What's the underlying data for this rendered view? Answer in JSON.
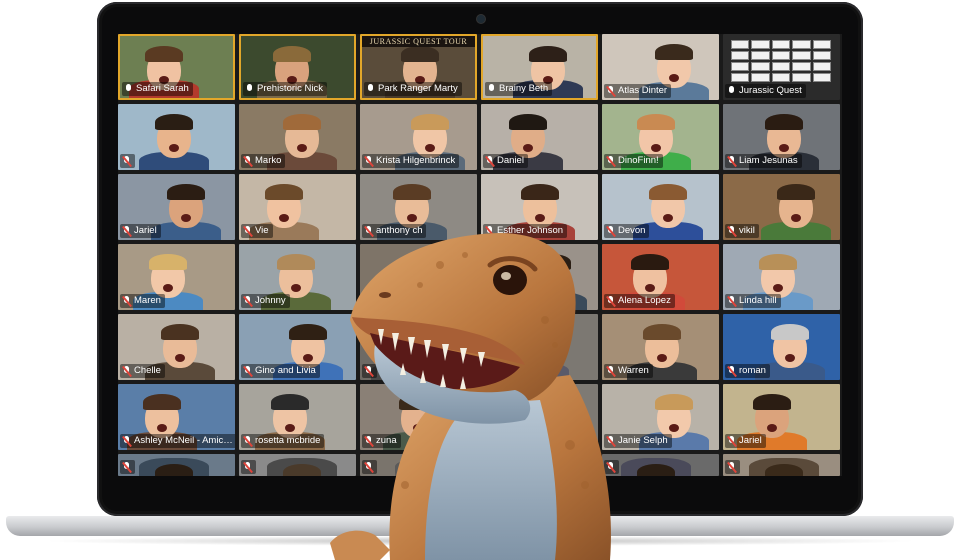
{
  "participants": [
    {
      "name": "Safari Sarah",
      "muted": false,
      "highlight": true,
      "bg": "#6d7f52",
      "skin": "#f0c2a2",
      "hair": "#5a3a22",
      "shirt": "#b33a2c"
    },
    {
      "name": "Prehistoric Nick",
      "muted": false,
      "highlight": true,
      "bg": "#3c4a2e",
      "skin": "#d9a27d",
      "hair": "#8a6a3a",
      "shirt": "#7a6a4a"
    },
    {
      "name": "Park Ranger Marty",
      "muted": false,
      "highlight": true,
      "bg": "#5a4c3a",
      "skin": "#e3b490",
      "hair": "#3b2e22",
      "shirt": "#4a3a2a",
      "banner": "JURASSIC QUEST TOUR"
    },
    {
      "name": "Brainy Beth",
      "muted": false,
      "highlight": true,
      "bg": "#b9b3a6",
      "skin": "#efc4a4",
      "hair": "#2d2018",
      "shirt": "#2f3a55"
    },
    {
      "name": "Atlas Dinter",
      "muted": true,
      "highlight": false,
      "bg": "#cfc6bb",
      "skin": "#f1c8aa",
      "hair": "#3a2a1c",
      "shirt": "#5b7a9a"
    },
    {
      "name": "Jurassic Quest",
      "muted": false,
      "highlight": false,
      "bg": "#2b2b2b",
      "board": true
    },
    {
      "name": "",
      "muted": true,
      "highlight": false,
      "bg": "#9fb8c9",
      "skin": "#e8b48c",
      "hair": "#2a1e14",
      "shirt": "#2f4c7a"
    },
    {
      "name": "Marko",
      "muted": true,
      "highlight": false,
      "bg": "#8a7a64",
      "skin": "#e6b996",
      "hair": "#a06a3a",
      "shirt": "#6b4a3a"
    },
    {
      "name": "Krista Hilgenbrinck",
      "muted": true,
      "highlight": false,
      "bg": "#a79b8e",
      "skin": "#f0c6a6",
      "hair": "#c99a5a",
      "shirt": "#5a6a7a"
    },
    {
      "name": "Daniel",
      "muted": true,
      "highlight": false,
      "bg": "#b7b0a8",
      "skin": "#e0ad88",
      "hair": "#1f1812",
      "shirt": "#3a3a44"
    },
    {
      "name": "DinoFinn!",
      "muted": true,
      "highlight": false,
      "bg": "#a3b48e",
      "skin": "#f2c6a8",
      "hair": "#c98a52",
      "shirt": "#3fae4a"
    },
    {
      "name": "Liam Jesunas",
      "muted": true,
      "highlight": false,
      "bg": "#6f7378",
      "skin": "#e9b894",
      "hair": "#2a1c12",
      "shirt": "#2a2f38"
    },
    {
      "name": "Jariel",
      "muted": true,
      "highlight": false,
      "bg": "#8b96a3",
      "skin": "#dba37c",
      "hair": "#2b1d13",
      "shirt": "#3b5e8a"
    },
    {
      "name": "Vie",
      "muted": true,
      "highlight": false,
      "bg": "#c4b7a6",
      "skin": "#f0c2a0",
      "hair": "#6b4a2a",
      "shirt": "#9a7a5a"
    },
    {
      "name": "anthony ch",
      "muted": true,
      "highlight": false,
      "bg": "#8e8a84",
      "skin": "#e9bc98",
      "hair": "#5a3c24",
      "shirt": "#4a5a6a"
    },
    {
      "name": "Esther Johnson",
      "muted": true,
      "highlight": false,
      "bg": "#c7c1b9",
      "skin": "#edc09c",
      "hair": "#3a2618",
      "shirt": "#a8423a"
    },
    {
      "name": "Devon",
      "muted": true,
      "highlight": false,
      "bg": "#b6c2cc",
      "skin": "#f1c7a9",
      "hair": "#8a5a32",
      "shirt": "#2d4f9a"
    },
    {
      "name": "vikil",
      "muted": true,
      "highlight": false,
      "bg": "#8b6a48",
      "skin": "#e6b48e",
      "hair": "#3a2818",
      "shirt": "#4a7a3a"
    },
    {
      "name": "Maren",
      "muted": true,
      "highlight": false,
      "bg": "#a89a86",
      "skin": "#f2c8a8",
      "hair": "#d7b26a",
      "shirt": "#4c8ac2"
    },
    {
      "name": "Johnny",
      "muted": true,
      "highlight": false,
      "bg": "#9aa3a8",
      "skin": "#ecbf9c",
      "hair": "#b08a5a",
      "shirt": "#5a6a3a"
    },
    {
      "name": "",
      "muted": true,
      "highlight": false,
      "bg": "#7e7468",
      "skin": "#e3b08a",
      "hair": "#3a2a1a",
      "shirt": "#6a5a4a"
    },
    {
      "name": "",
      "muted": true,
      "highlight": false,
      "bg": "#9a928a",
      "skin": "#e8b692",
      "hair": "#2a1e14",
      "shirt": "#3a4a5a"
    },
    {
      "name": "Alena Lopez",
      "muted": true,
      "highlight": false,
      "bg": "#c6563a",
      "skin": "#efc1a0",
      "hair": "#2a1a10",
      "shirt": "#d14a3a"
    },
    {
      "name": "Linda hill",
      "muted": true,
      "highlight": false,
      "bg": "#9fa9b4",
      "skin": "#f2c8aa",
      "hair": "#b89058",
      "shirt": "#6a9ac8"
    },
    {
      "name": "Chelle",
      "muted": true,
      "highlight": false,
      "bg": "#b9b0a4",
      "skin": "#e9bb98",
      "hair": "#4a3220",
      "shirt": "#5a4a3a"
    },
    {
      "name": "Gino and Livia",
      "muted": true,
      "highlight": false,
      "bg": "#8aa0b4",
      "skin": "#efc3a2",
      "hair": "#2f2014",
      "shirt": "#3f72b8"
    },
    {
      "name": "",
      "muted": true,
      "highlight": false,
      "bg": "#6e6a64",
      "skin": "#e4b28c",
      "hair": "#3a2a1a",
      "shirt": "#4a4a4a"
    },
    {
      "name": "",
      "muted": true,
      "highlight": false,
      "bg": "#7c7872",
      "skin": "#e6b690",
      "hair": "#2c1e12",
      "shirt": "#5a5a6a"
    },
    {
      "name": "Warren",
      "muted": true,
      "highlight": false,
      "bg": "#a58f76",
      "skin": "#ecbe9a",
      "hair": "#6a4a2c",
      "shirt": "#3a3a3a"
    },
    {
      "name": "roman",
      "muted": true,
      "highlight": false,
      "bg": "#2f62a8",
      "skin": "#f0c4a4",
      "hair": "#c8c8c8",
      "shirt": "#3a5a8a"
    },
    {
      "name": "Ashley McNeil - Amica...",
      "muted": true,
      "highlight": false,
      "bg": "#5a7ea8",
      "skin": "#edc09e",
      "hair": "#4a3020",
      "shirt": "#6a4a3a"
    },
    {
      "name": "rosetta mcbride",
      "muted": true,
      "highlight": false,
      "bg": "#a7a49c",
      "skin": "#eec4a4",
      "hair": "#2a2a2a",
      "shirt": "#8a6a4a"
    },
    {
      "name": "zuna",
      "muted": true,
      "highlight": false,
      "bg": "#8a8076",
      "skin": "#e4b28e",
      "hair": "#3a2a1a",
      "shirt": "#4a5a4a"
    },
    {
      "name": "",
      "muted": true,
      "highlight": false,
      "bg": "#7e7a74",
      "skin": "#e6b692",
      "hair": "#2e2016",
      "shirt": "#5a4a3a"
    },
    {
      "name": "Janie Selph",
      "muted": true,
      "highlight": false,
      "bg": "#b8b2a8",
      "skin": "#f2c9ab",
      "hair": "#c89a5a",
      "shirt": "#5a7aaa"
    },
    {
      "name": "Jariel",
      "muted": true,
      "highlight": false,
      "bg": "#c2b48e",
      "skin": "#dba37c",
      "hair": "#2b1d13",
      "shirt": "#e07a2a"
    },
    {
      "name": "",
      "muted": true,
      "highlight": false,
      "bg": "#6a7a8a",
      "skin": "#e8b692",
      "hair": "#2a1e14",
      "shirt": "#3a4a5a"
    },
    {
      "name": "",
      "muted": true,
      "highlight": false,
      "bg": "#8a8a8a",
      "skin": "#e8b692",
      "hair": "#4a3a2a",
      "shirt": "#4a4a4a"
    },
    {
      "name": "",
      "muted": true,
      "highlight": false,
      "bg": "#7a746c",
      "skin": "#e8b692",
      "hair": "#3a2a1a",
      "shirt": "#5a5a5a"
    },
    {
      "name": "",
      "muted": true,
      "highlight": false,
      "bg": "#7a746c",
      "skin": "#e8b692",
      "hair": "#3a2a1a",
      "shirt": "#5a5a5a"
    },
    {
      "name": "",
      "muted": true,
      "highlight": false,
      "bg": "#6a6a6a",
      "skin": "#e3b08a",
      "hair": "#2a1e14",
      "shirt": "#4a4a5a"
    },
    {
      "name": "",
      "muted": true,
      "highlight": false,
      "bg": "#9a8e80",
      "skin": "#e8b692",
      "hair": "#3a2a1a",
      "shirt": "#5a4a3a"
    }
  ],
  "colors": {
    "highlight_border": "#e2a72a",
    "mute_slash": "#e0443a",
    "screen_bg": "#1a1a1a",
    "dino_body": "#c98a52",
    "dino_belly": "#9fb2c2"
  }
}
